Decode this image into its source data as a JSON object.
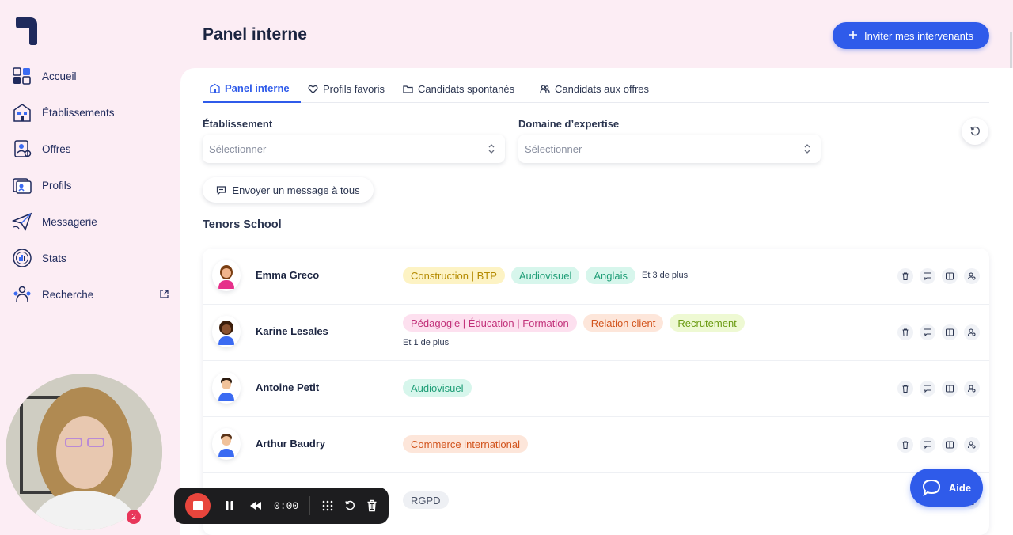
{
  "header": {
    "title": "Panel interne",
    "invite_label": "Inviter mes intervenants"
  },
  "sidebar": {
    "items": [
      {
        "label": "Accueil",
        "icon": "home-grid-icon"
      },
      {
        "label": "Établissements",
        "icon": "building-icon"
      },
      {
        "label": "Offres",
        "icon": "offer-icon"
      },
      {
        "label": "Profils",
        "icon": "profiles-icon"
      },
      {
        "label": "Messagerie",
        "icon": "paper-plane-icon"
      },
      {
        "label": "Stats",
        "icon": "stats-icon"
      },
      {
        "label": "Recherche",
        "icon": "people-search-icon"
      }
    ]
  },
  "tabs": [
    {
      "label": "Panel interne",
      "active": true
    },
    {
      "label": "Profils favoris",
      "active": false
    },
    {
      "label": "Candidats spontanés",
      "active": false
    },
    {
      "label": "Candidats aux offres",
      "active": false
    }
  ],
  "filters": {
    "etablissement": {
      "label": "Établissement",
      "placeholder": "Sélectionner"
    },
    "domaine": {
      "label": "Domaine d’expertise",
      "placeholder": "Sélectionner"
    }
  },
  "message_all_label": "Envoyer un message à tous",
  "section_title": "Tenors School",
  "people": [
    {
      "name": "Emma Greco",
      "tags": [
        {
          "text": "Construction | BTP",
          "bg": "#fdf3c4",
          "fg": "#b48a00"
        },
        {
          "text": "Audiovisuel",
          "bg": "#d7f6ec",
          "fg": "#1f9e77"
        },
        {
          "text": "Anglais",
          "bg": "#d7f6ec",
          "fg": "#1f9e77"
        }
      ],
      "more": "Et 3 de plus"
    },
    {
      "name": "Karine Lesales",
      "tags": [
        {
          "text": "Pédagogie | Éducation | Formation",
          "bg": "#fde0ef",
          "fg": "#c2317a"
        },
        {
          "text": "Relation client",
          "bg": "#fde6da",
          "fg": "#d2541d"
        },
        {
          "text": "Recrutement",
          "bg": "#eef9d3",
          "fg": "#6b9b12"
        }
      ],
      "more": "Et 1 de plus"
    },
    {
      "name": "Antoine Petit",
      "tags": [
        {
          "text": "Audiovisuel",
          "bg": "#d7f6ec",
          "fg": "#1f9e77"
        }
      ],
      "more": ""
    },
    {
      "name": "Arthur Baudry",
      "tags": [
        {
          "text": "Commerce international",
          "bg": "#fde6da",
          "fg": "#d2541d"
        }
      ],
      "more": ""
    },
    {
      "name": "",
      "tags": [
        {
          "text": "RGPD",
          "bg": "#eef0f4",
          "fg": "#4a5266"
        }
      ],
      "more": ""
    }
  ],
  "recorder": {
    "time": "0:00"
  },
  "aide_label": "Aide",
  "notification_count": "2",
  "colors": {
    "accent": "#2f5bea",
    "sidebar_bg": "#fcedf4",
    "record_red": "#e8453c"
  }
}
